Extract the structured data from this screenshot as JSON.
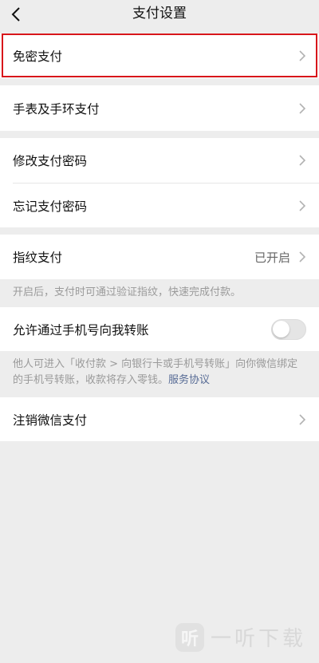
{
  "header": {
    "title": "支付设置",
    "back_icon": "chevron-left-icon"
  },
  "group1": {
    "no_password_pay": "免密支付",
    "watch_band_pay": "手表及手环支付"
  },
  "group2": {
    "change_password": "修改支付密码",
    "forgot_password": "忘记支付密码"
  },
  "fingerprint": {
    "label": "指纹支付",
    "status": "已开启",
    "note": "开启后，支付时可通过验证指纹，快速完成付款。"
  },
  "phone_transfer": {
    "label": "允许通过手机号向我转账",
    "enabled": false,
    "note_text": "他人可进入「收付款 > 向银行卡或手机号转账」向你微信绑定的手机号转账，收款将存入零钱。",
    "note_link": "服务协议"
  },
  "cancel_pay": {
    "label": "注销微信支付"
  },
  "watermark": {
    "logo": "听",
    "text": "一听下载"
  },
  "colors": {
    "highlight": "#d8161b",
    "link": "#576b95",
    "background": "#ededed"
  }
}
